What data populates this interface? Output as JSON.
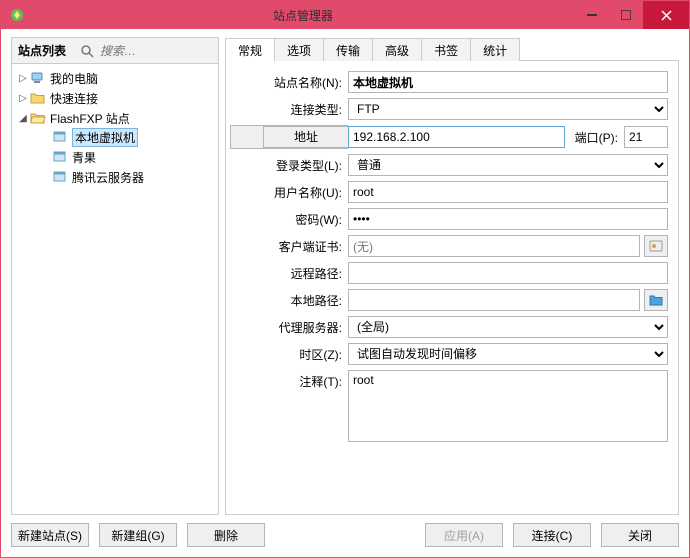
{
  "window": {
    "title": "站点管理器"
  },
  "sidebar": {
    "title": "站点列表",
    "search_placeholder": "搜索…",
    "nodes": {
      "my_computer": "我的电脑",
      "quick_connect": "快速连接",
      "flashfxp_sites": "FlashFXP 站点",
      "local_vm": "本地虚拟机",
      "qingguo": "青果",
      "tencent_cloud": "腾讯云服务器"
    }
  },
  "tabs": {
    "general": "常规",
    "options": "选项",
    "transfer": "传输",
    "advanced": "高级",
    "bookmarks": "书签",
    "stats": "统计"
  },
  "form": {
    "site_name_label": "站点名称(N):",
    "site_name_value": "本地虚拟机",
    "conn_type_label": "连接类型:",
    "conn_type_value": "FTP",
    "address_btn": "地址",
    "address_value": "192.168.2.100",
    "port_label": "端口(P):",
    "port_value": "21",
    "login_type_label": "登录类型(L):",
    "login_type_value": "普通",
    "username_label": "用户名称(U):",
    "username_value": "root",
    "password_label": "密码(W):",
    "password_value": "••••",
    "client_cert_label": "客户端证书:",
    "client_cert_value": "(无)",
    "remote_path_label": "远程路径:",
    "remote_path_value": "",
    "local_path_label": "本地路径:",
    "local_path_value": "",
    "proxy_label": "代理服务器:",
    "proxy_value": "(全局)",
    "timezone_label": "时区(Z):",
    "timezone_value": "试图自动发现时间偏移",
    "notes_label": "注释(T):",
    "notes_value": "root"
  },
  "buttons": {
    "new_site": "新建站点(S)",
    "new_group": "新建组(G)",
    "delete": "删除",
    "apply": "应用(A)",
    "connect": "连接(C)",
    "close": "关闭"
  }
}
